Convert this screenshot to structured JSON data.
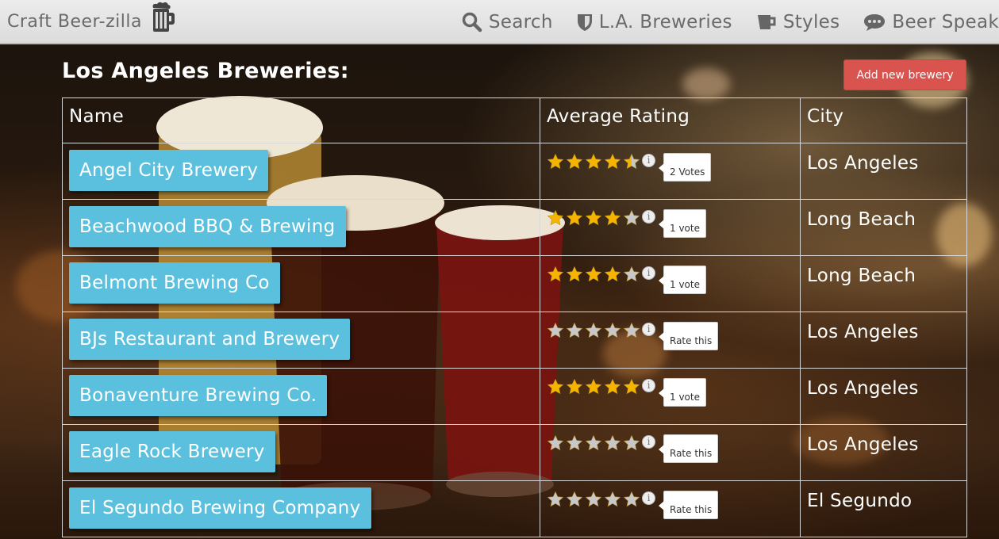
{
  "navbar": {
    "brand": "Craft Beer-zilla",
    "brand_icon": "beer-mug-icon",
    "items": [
      {
        "label": "Search",
        "icon": "search-icon"
      },
      {
        "label": "L.A. Breweries",
        "icon": "shield-icon"
      },
      {
        "label": "Styles",
        "icon": "beer-glass-icon"
      },
      {
        "label": "Beer Speak",
        "icon": "speech-bubble-icon"
      }
    ]
  },
  "page": {
    "title": "Los Angeles Breweries:",
    "add_button": "Add new brewery"
  },
  "table": {
    "headers": [
      "Name",
      "Average Rating",
      "City"
    ],
    "rows": [
      {
        "name": "Angel City Brewery",
        "stars": 4.5,
        "votes": "2 Votes",
        "city": "Los Angeles"
      },
      {
        "name": "Beachwood BBQ & Brewing",
        "stars": 4,
        "votes": "1 vote",
        "city": "Long Beach"
      },
      {
        "name": "Belmont Brewing Co",
        "stars": 4,
        "votes": "1 vote",
        "city": "Long Beach"
      },
      {
        "name": "BJs Restaurant and Brewery",
        "stars": 0,
        "votes": "Rate this",
        "city": "Los Angeles"
      },
      {
        "name": "Bonaventure Brewing Co.",
        "stars": 5,
        "votes": "1 vote",
        "city": "Los Angeles"
      },
      {
        "name": "Eagle Rock Brewery",
        "stars": 0,
        "votes": "Rate this",
        "city": "Los Angeles"
      },
      {
        "name": "El Segundo Brewing Company",
        "stars": 0,
        "votes": "Rate this",
        "city": "El Segundo"
      }
    ]
  },
  "colors": {
    "navbar_bg": "#e3e3e3",
    "navbar_text": "#6a6a6a",
    "name_button": "#5bc0de",
    "add_button": "#d9534f",
    "star_filled": "#f5b400",
    "star_empty": "#c8c8c8"
  }
}
